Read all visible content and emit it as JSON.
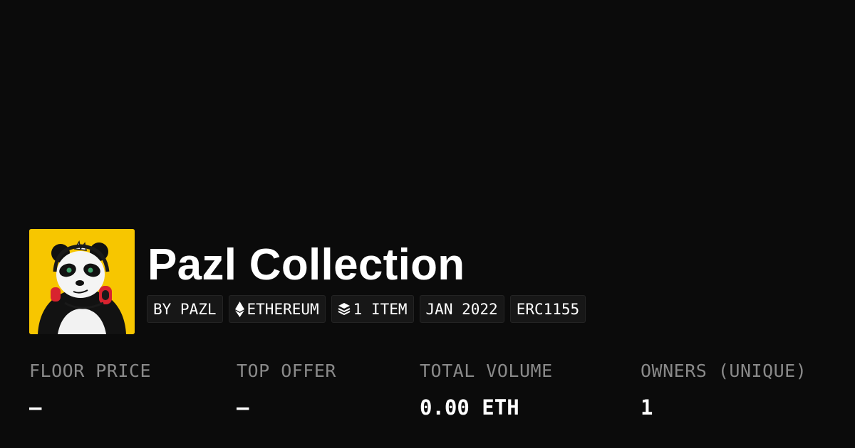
{
  "collection": {
    "name": "Pazl Collection",
    "avatar_icon": "panda-headphones-icon",
    "accent_color": "#f7c600"
  },
  "chips": [
    {
      "label": "BY PAZL"
    },
    {
      "label": "ETHEREUM",
      "icon": "ethereum-icon"
    },
    {
      "label": "1 ITEM",
      "icon": "layers-icon"
    },
    {
      "label": "JAN 2022"
    },
    {
      "label": "ERC1155"
    }
  ],
  "stats": [
    {
      "label": "FLOOR PRICE",
      "value": "—"
    },
    {
      "label": "TOP OFFER",
      "value": "—"
    },
    {
      "label": "TOTAL VOLUME",
      "value": "0.00 ETH"
    },
    {
      "label": "OWNERS (UNIQUE)",
      "value": "1"
    }
  ]
}
